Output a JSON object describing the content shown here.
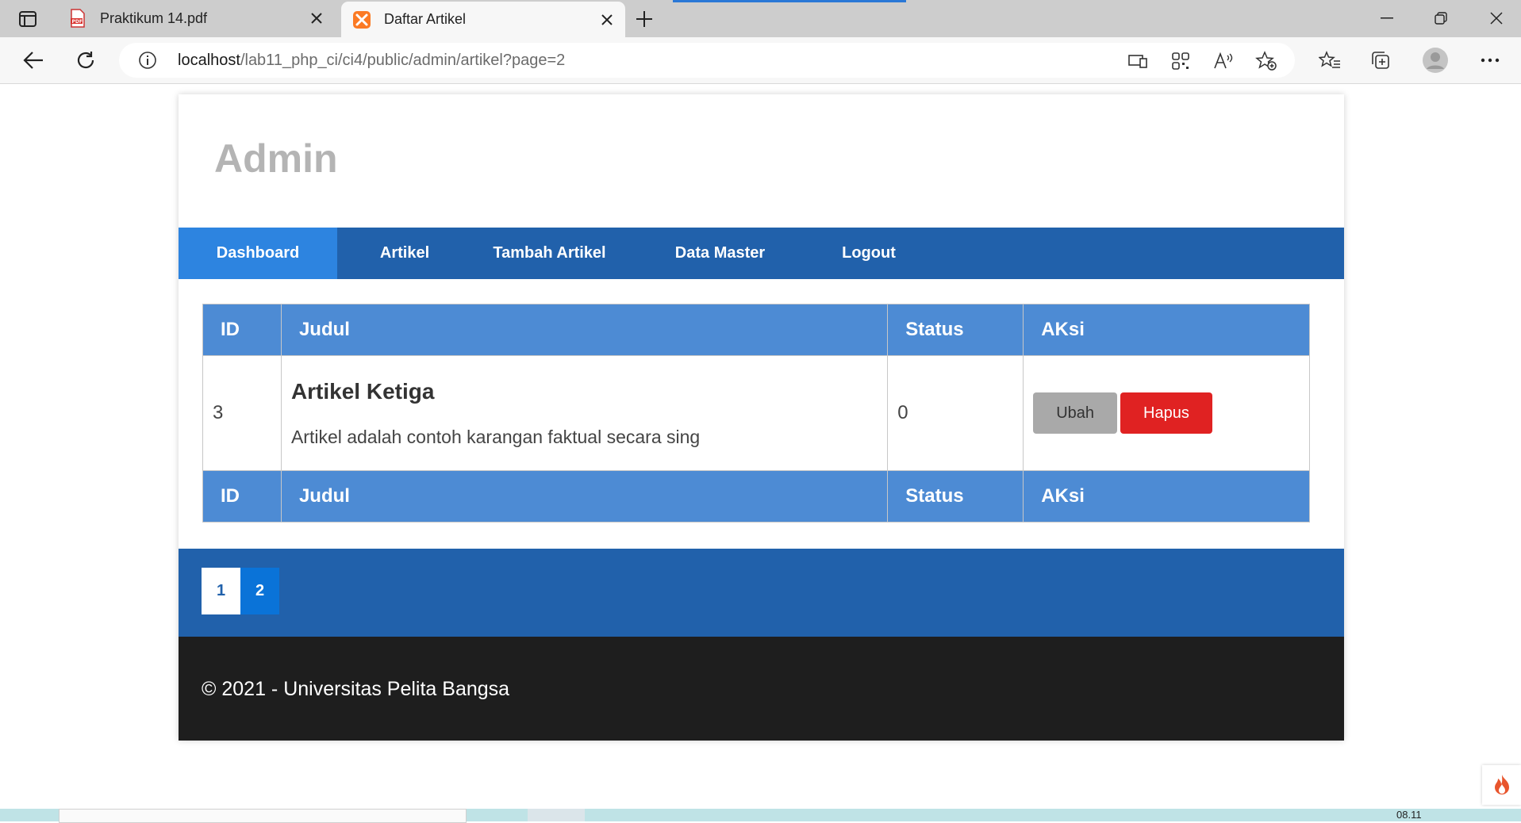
{
  "browser": {
    "tabs": [
      {
        "title": "Praktikum 14.pdf",
        "favicon": "pdf-icon"
      },
      {
        "title": "Daftar Artikel",
        "favicon": "xampp-icon",
        "active": true
      }
    ],
    "address": {
      "host": "localhost",
      "path": "/lab11_php_ci/ci4/public/admin/artikel?page=2"
    }
  },
  "site": {
    "title": "Admin"
  },
  "nav": {
    "items": [
      {
        "label": "Dashboard",
        "active": true
      },
      {
        "label": "Artikel"
      },
      {
        "label": "Tambah Artikel"
      },
      {
        "label": "Data Master"
      },
      {
        "label": "Logout"
      }
    ]
  },
  "table": {
    "headers": [
      "ID",
      "Judul",
      "Status",
      "AKsi"
    ],
    "rows": [
      {
        "id": "3",
        "title": "Artikel Ketiga",
        "excerpt": "Artikel adalah contoh karangan faktual secara sing",
        "status": "0",
        "actions": {
          "edit": "Ubah",
          "delete": "Hapus"
        }
      }
    ]
  },
  "pagination": {
    "pages": [
      "1",
      "2"
    ],
    "current": "2"
  },
  "footer": {
    "text": "© 2021 - Universitas Pelita Bangsa"
  },
  "taskbar": {
    "clock": "08.11"
  },
  "colors": {
    "nav_bg": "#2161ab",
    "nav_active": "#2d84e0",
    "table_header": "#4d8bd4",
    "delete_button": "#e02222",
    "edit_button": "#a9a9a9",
    "footer_bg": "#1e1e1e",
    "title_gray": "#b4b4b4"
  }
}
